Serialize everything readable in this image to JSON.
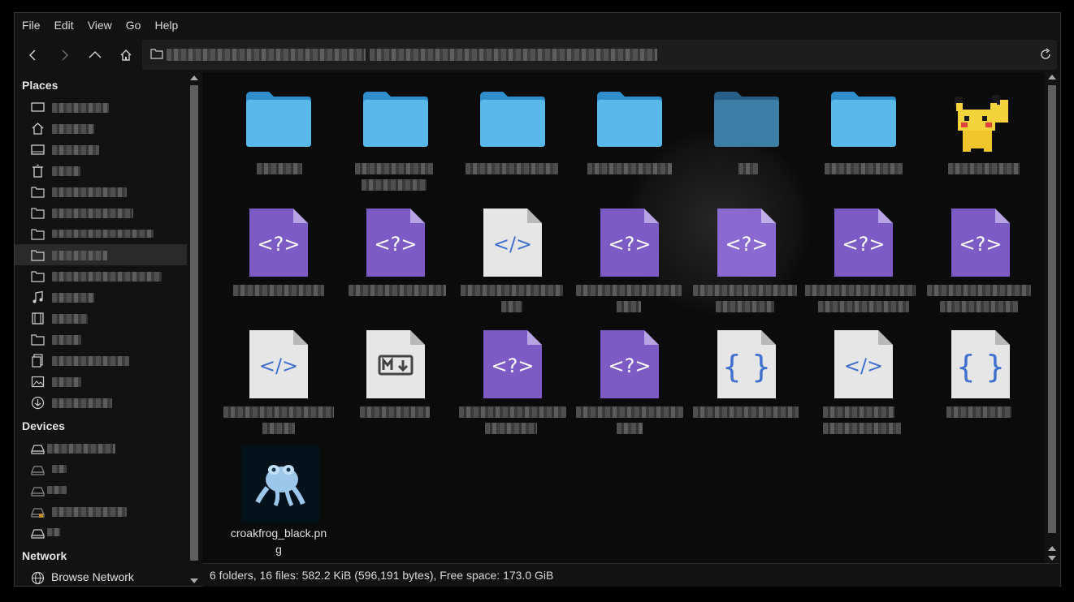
{
  "menu": [
    "File",
    "Edit",
    "View",
    "Go",
    "Help"
  ],
  "sidebar": {
    "places_title": "Places",
    "devices_title": "Devices",
    "network_title": "Network",
    "network_items": [
      {
        "label": "Browse Network",
        "icon": "network-icon"
      }
    ]
  },
  "files": {
    "visible_named_file": "croakfrog_black.png",
    "grid": [
      [
        "folder",
        "folder",
        "folder",
        "folder",
        "folder-dim",
        "folder",
        "pikachu-image"
      ],
      [
        "php",
        "php",
        "html",
        "php",
        "php",
        "php",
        "php"
      ],
      [
        "html",
        "markdown",
        "php",
        "php",
        "json",
        "html",
        "json"
      ],
      [
        "frog-image"
      ]
    ]
  },
  "status": {
    "text": "6 folders, 16 files: 582.2 KiB (596,191 bytes), Free space: 173.0 GiB"
  },
  "colors": {
    "folder": "#4aa6de",
    "php": "#7c5bc4",
    "code_doc": "#e6e6e6",
    "code_glyph": "#3f6fcf"
  }
}
